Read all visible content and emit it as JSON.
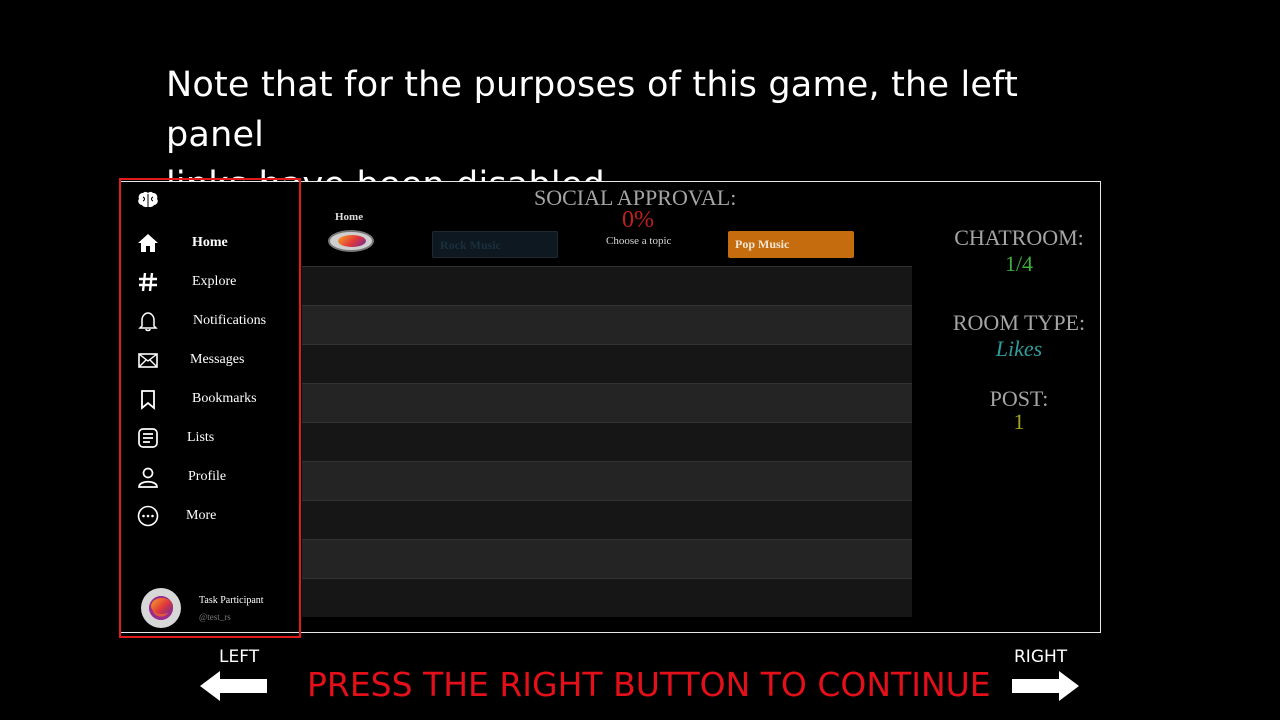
{
  "instruction": {
    "line1": "Note that for the purposes of this game, the left panel",
    "line2": "links have been disabled."
  },
  "sidebar": {
    "logo_icon": "brain-icon",
    "items": [
      {
        "label": "Home",
        "icon": "home-icon",
        "active": true
      },
      {
        "label": "Explore",
        "icon": "hashtag-icon"
      },
      {
        "label": "Notifications",
        "icon": "bell-icon"
      },
      {
        "label": "Messages",
        "icon": "envelope-icon"
      },
      {
        "label": "Bookmarks",
        "icon": "bookmark-icon"
      },
      {
        "label": "Lists",
        "icon": "list-icon"
      },
      {
        "label": "Profile",
        "icon": "person-icon"
      },
      {
        "label": "More",
        "icon": "more-icon"
      }
    ],
    "user": {
      "name": "Task Participant",
      "handle": "@test_rs"
    }
  },
  "feed": {
    "home_label": "Home",
    "approval_title": "SOCIAL APPROVAL:",
    "approval_value": "0%",
    "choose_topic": "Choose a topic",
    "topics": [
      {
        "label": "Rock Music"
      },
      {
        "label": "Pop Music"
      }
    ],
    "row_count": 9
  },
  "right_panel": {
    "chatroom_label": "CHATROOM:",
    "chatroom_value": "1/4",
    "room_type_label": "ROOM TYPE:",
    "room_type_value": "Likes",
    "post_label": "POST:",
    "post_value": "1"
  },
  "navigation": {
    "left_label": "LEFT",
    "right_label": "RIGHT",
    "prompt": "PRESS THE RIGHT BUTTON TO CONTINUE"
  },
  "colors": {
    "accent_red": "#e3101a",
    "approval_red": "#c01f1f",
    "chatroom_green": "#3fae3f",
    "room_type_teal": "#2f9c9c",
    "post_olive": "#a3a321",
    "pop_orange": "#c56d0e"
  }
}
